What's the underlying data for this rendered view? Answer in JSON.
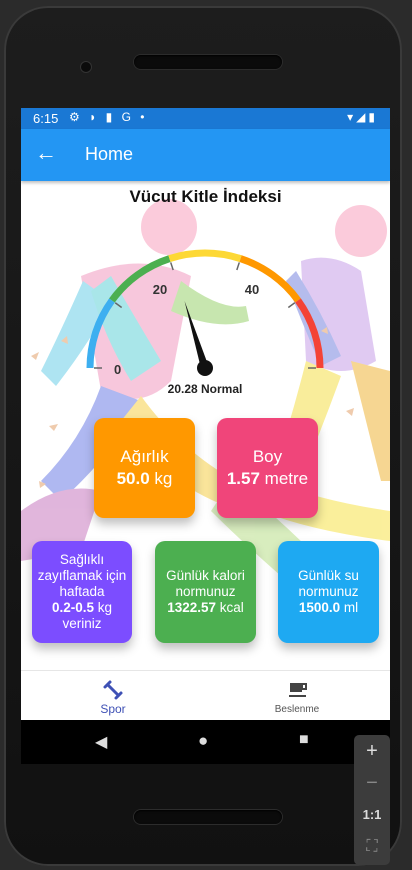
{
  "status_bar": {
    "time": "6:15",
    "left_icons": "⚙ ◗ ▮ G •",
    "right_icons": "▾◢▮"
  },
  "app_bar": {
    "back_icon": "arrow-back-icon",
    "title": "Home"
  },
  "bmi": {
    "heading": "Vücut Kitle İndeksi",
    "gauge_ticks": [
      "0",
      "20",
      "40"
    ],
    "value_text": "20.28 Normal",
    "value": 20.28,
    "range": [
      0,
      50
    ],
    "zone_colors": [
      "#3daff0",
      "#4caf50",
      "#fdd835",
      "#ff9800",
      "#f44336"
    ]
  },
  "cards": {
    "weight": {
      "label": "Ağırlık",
      "value": "50.0",
      "unit": "kg",
      "color": "#ff9800"
    },
    "height": {
      "label": "Boy",
      "value": "1.57",
      "unit": "metre",
      "color": "#f0457a"
    },
    "advice": {
      "line1": "Sağlıklı zayıflamak için haftada",
      "value": "0.2-0.5",
      "unit": "kg",
      "line2": "veriniz",
      "color": "#7c4dff"
    },
    "calorie": {
      "label": "Günlük kalori normunuz",
      "value": "1322.57",
      "unit": "kcal",
      "color": "#4caf50"
    },
    "water": {
      "label": "Günlük su normunuz",
      "value": "1500.0",
      "unit": "ml",
      "color": "#1ea9f2"
    }
  },
  "bottom_nav": [
    {
      "label": "Spor",
      "icon": "dumbbell-icon",
      "active": true
    },
    {
      "label": "Beslenme",
      "icon": "coffee-cup-icon",
      "active": false
    }
  ],
  "system_nav": {
    "back": "◀",
    "home": "●",
    "recents": "■"
  },
  "zoom_controls": {
    "plus": "+",
    "minus": "−",
    "ratio": "1:1",
    "fit": "⛶"
  }
}
